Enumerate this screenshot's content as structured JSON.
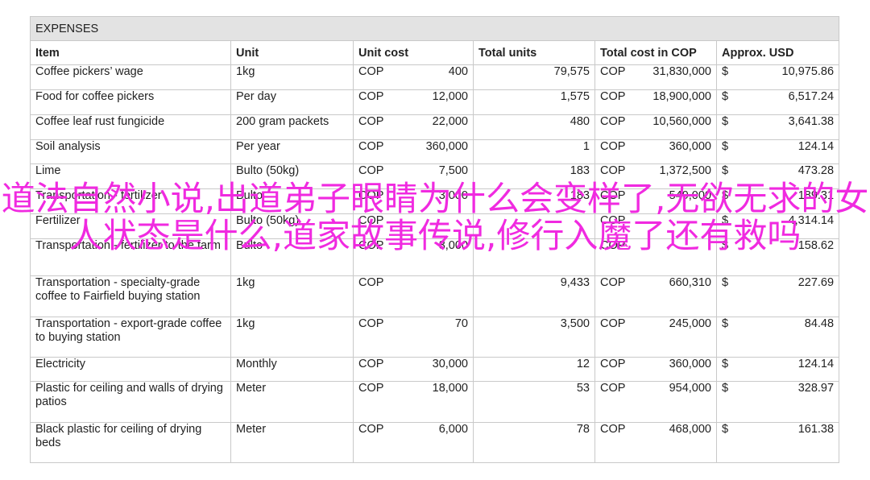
{
  "table": {
    "title": "EXPENSES",
    "headers": [
      "Item",
      "Unit",
      "Unit cost",
      "Total units",
      "Total cost in COP",
      "Approx. USD"
    ],
    "rows": [
      {
        "item": "Coffee pickers’ wage",
        "unit": "1kg",
        "unit_cost_cur": "COP",
        "unit_cost": "400",
        "total_units": "79,575",
        "total_cur": "COP",
        "total_cost": "31,830,000",
        "usd_cur": "$",
        "usd": "10,975.86"
      },
      {
        "item": "Food for coffee pickers",
        "unit": "Per day",
        "unit_cost_cur": "COP",
        "unit_cost": "12,000",
        "total_units": "1,575",
        "total_cur": "COP",
        "total_cost": "18,900,000",
        "usd_cur": "$",
        "usd": "6,517.24"
      },
      {
        "item": "Coffee leaf rust fungicide",
        "unit": "200 gram packets",
        "unit_cost_cur": "COP",
        "unit_cost": "22,000",
        "total_units": "480",
        "total_cur": "COP",
        "total_cost": "10,560,000",
        "usd_cur": "$",
        "usd": "3,641.38"
      },
      {
        "item": "Soil analysis",
        "unit": "Per year",
        "unit_cost_cur": "COP",
        "unit_cost": "360,000",
        "total_units": "1",
        "total_cur": "COP",
        "total_cost": "360,000",
        "usd_cur": "$",
        "usd": "124.14"
      },
      {
        "item": "Lime",
        "unit": "Bulto (50kg)",
        "unit_cost_cur": "COP",
        "unit_cost": "7,500",
        "total_units": "183",
        "total_cur": "COP",
        "total_cost": "1,372,500",
        "usd_cur": "$",
        "usd": "473.28"
      },
      {
        "item": "Transportation - fertilizer",
        "unit": "Bulto",
        "unit_cost_cur": "COP",
        "unit_cost": "3,000",
        "total_units": "183",
        "total_cur": "COP",
        "total_cost": "549,000",
        "usd_cur": "$",
        "usd": "189.31"
      },
      {
        "item": "Fertilizer",
        "unit": "Bulto (50kg)",
        "unit_cost_cur": "COP",
        "unit_cost": "",
        "total_units": "",
        "total_cur": "COP",
        "total_cost": "",
        "usd_cur": "$",
        "usd": "4,314.14"
      },
      {
        "item": "Transportation - fertilizer to the farm",
        "unit": "Bulto",
        "unit_cost_cur": "COP",
        "unit_cost": "3,000",
        "total_units": "",
        "total_cur": "COP",
        "total_cost": "",
        "usd_cur": "$",
        "usd": "158.62"
      },
      {
        "item": "Transportation - specialty-grade coffee to Fairfield buying station",
        "unit": "1kg",
        "unit_cost_cur": "COP",
        "unit_cost": "",
        "total_units": "9,433",
        "total_cur": "COP",
        "total_cost": "660,310",
        "usd_cur": "$",
        "usd": "227.69"
      },
      {
        "item": "Transportation - export-grade coffee to buying station",
        "unit": "1kg",
        "unit_cost_cur": "COP",
        "unit_cost": "70",
        "total_units": "3,500",
        "total_cur": "COP",
        "total_cost": "245,000",
        "usd_cur": "$",
        "usd": "84.48"
      },
      {
        "item": "Electricity",
        "unit": "Monthly",
        "unit_cost_cur": "COP",
        "unit_cost": "30,000",
        "total_units": "12",
        "total_cur": "COP",
        "total_cost": "360,000",
        "usd_cur": "$",
        "usd": "124.14"
      },
      {
        "item": "Plastic for ceiling and walls of drying patios",
        "unit": "Meter",
        "unit_cost_cur": "COP",
        "unit_cost": "18,000",
        "total_units": "53",
        "total_cur": "COP",
        "total_cost": "954,000",
        "usd_cur": "$",
        "usd": "328.97"
      },
      {
        "item": "Black plastic for ceiling of drying beds",
        "unit": "Meter",
        "unit_cost_cur": "COP",
        "unit_cost": "6,000",
        "total_units": "78",
        "total_cur": "COP",
        "total_cost": "468,000",
        "usd_cur": "$",
        "usd": "161.38"
      }
    ]
  },
  "watermark": "道法自然小说,出道弟子眼睛为什么会变样了,无欲无求的女人状态是什么,道家故事传说,修行入魔了还有救吗"
}
